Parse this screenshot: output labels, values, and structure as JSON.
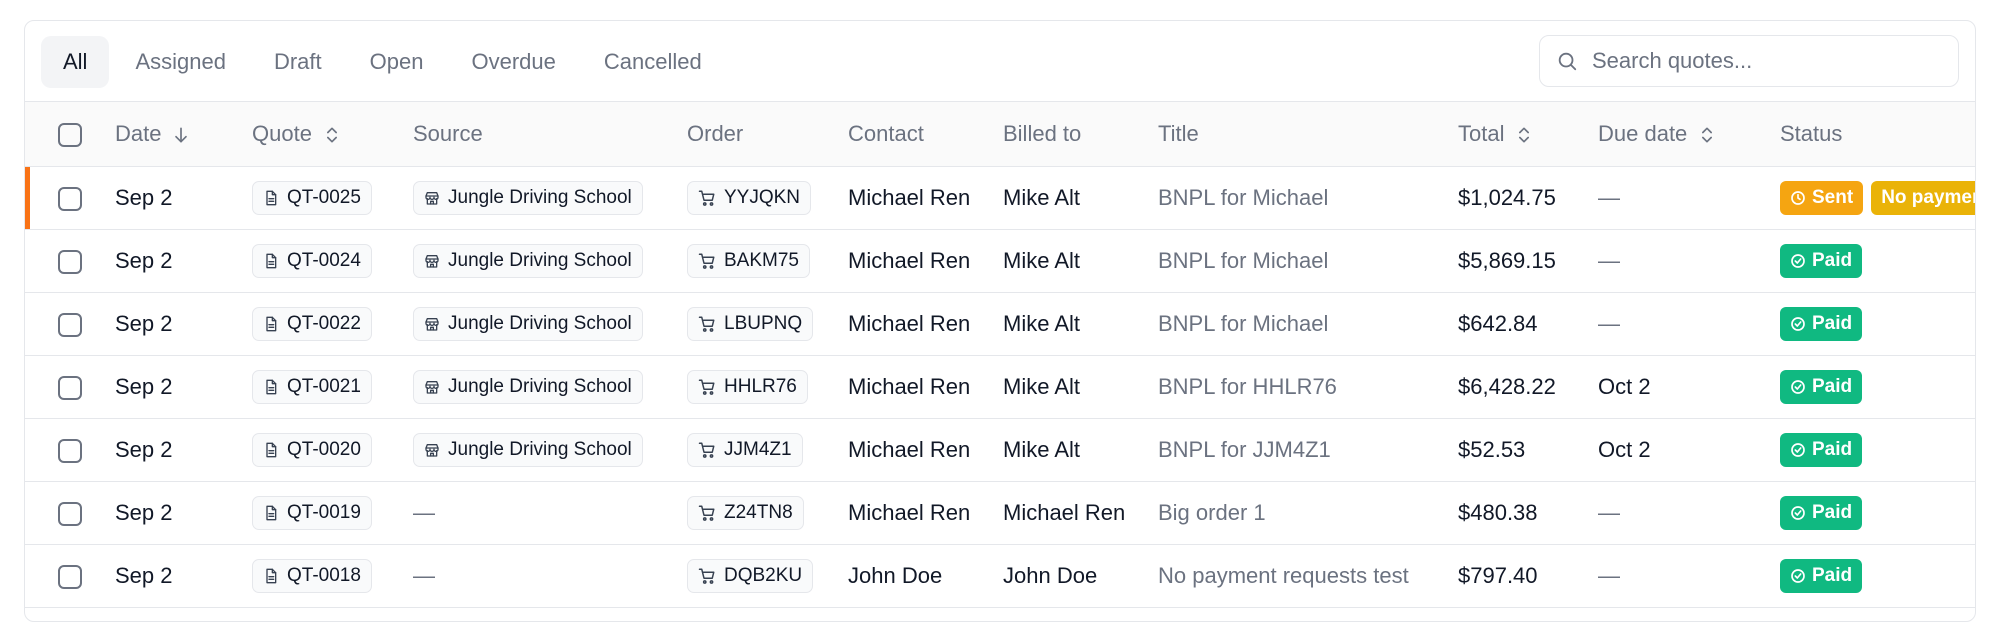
{
  "tabs": [
    {
      "label": "All",
      "active": true
    },
    {
      "label": "Assigned",
      "active": false
    },
    {
      "label": "Draft",
      "active": false
    },
    {
      "label": "Open",
      "active": false
    },
    {
      "label": "Overdue",
      "active": false
    },
    {
      "label": "Cancelled",
      "active": false
    }
  ],
  "search": {
    "placeholder": "Search quotes..."
  },
  "columns": {
    "date": "Date",
    "quote": "Quote",
    "source": "Source",
    "order": "Order",
    "contact": "Contact",
    "billed_to": "Billed to",
    "title": "Title",
    "total": "Total",
    "due_date": "Due date",
    "status": "Status"
  },
  "colors": {
    "paid": "#10b981",
    "sent": "#f5a511",
    "no_payment": "#eab308",
    "selected_row_marker": "#f97316"
  },
  "rows": [
    {
      "date": "Sep 2",
      "quote": "QT-0025",
      "source": "Jungle Driving School",
      "order": "YYJQKN",
      "contact": "Michael Ren",
      "billed_to": "Mike Alt",
      "title": "BNPL for Michael",
      "total": "$1,024.75",
      "due": "—",
      "status": "Sent",
      "extra_status": "No payment",
      "selected": true
    },
    {
      "date": "Sep 2",
      "quote": "QT-0024",
      "source": "Jungle Driving School",
      "order": "BAKM75",
      "contact": "Michael Ren",
      "billed_to": "Mike Alt",
      "title": "BNPL for Michael",
      "total": "$5,869.15",
      "due": "—",
      "status": "Paid"
    },
    {
      "date": "Sep 2",
      "quote": "QT-0022",
      "source": "Jungle Driving School",
      "order": "LBUPNQ",
      "contact": "Michael Ren",
      "billed_to": "Mike Alt",
      "title": "BNPL for Michael",
      "total": "$642.84",
      "due": "—",
      "status": "Paid"
    },
    {
      "date": "Sep 2",
      "quote": "QT-0021",
      "source": "Jungle Driving School",
      "order": "HHLR76",
      "contact": "Michael Ren",
      "billed_to": "Mike Alt",
      "title": "BNPL for HHLR76",
      "total": "$6,428.22",
      "due": "Oct 2",
      "status": "Paid"
    },
    {
      "date": "Sep 2",
      "quote": "QT-0020",
      "source": "Jungle Driving School",
      "order": "JJM4Z1",
      "contact": "Michael Ren",
      "billed_to": "Mike Alt",
      "title": "BNPL for JJM4Z1",
      "total": "$52.53",
      "due": "Oct 2",
      "status": "Paid"
    },
    {
      "date": "Sep 2",
      "quote": "QT-0019",
      "source": "—",
      "order": "Z24TN8",
      "contact": "Michael Ren",
      "billed_to": "Michael Ren",
      "title": "Big order 1",
      "total": "$480.38",
      "due": "—",
      "status": "Paid"
    },
    {
      "date": "Sep 2",
      "quote": "QT-0018",
      "source": "—",
      "order": "DQB2KU",
      "contact": "John Doe",
      "billed_to": "John Doe",
      "title": "No payment requests test",
      "total": "$797.40",
      "due": "—",
      "status": "Paid"
    }
  ]
}
